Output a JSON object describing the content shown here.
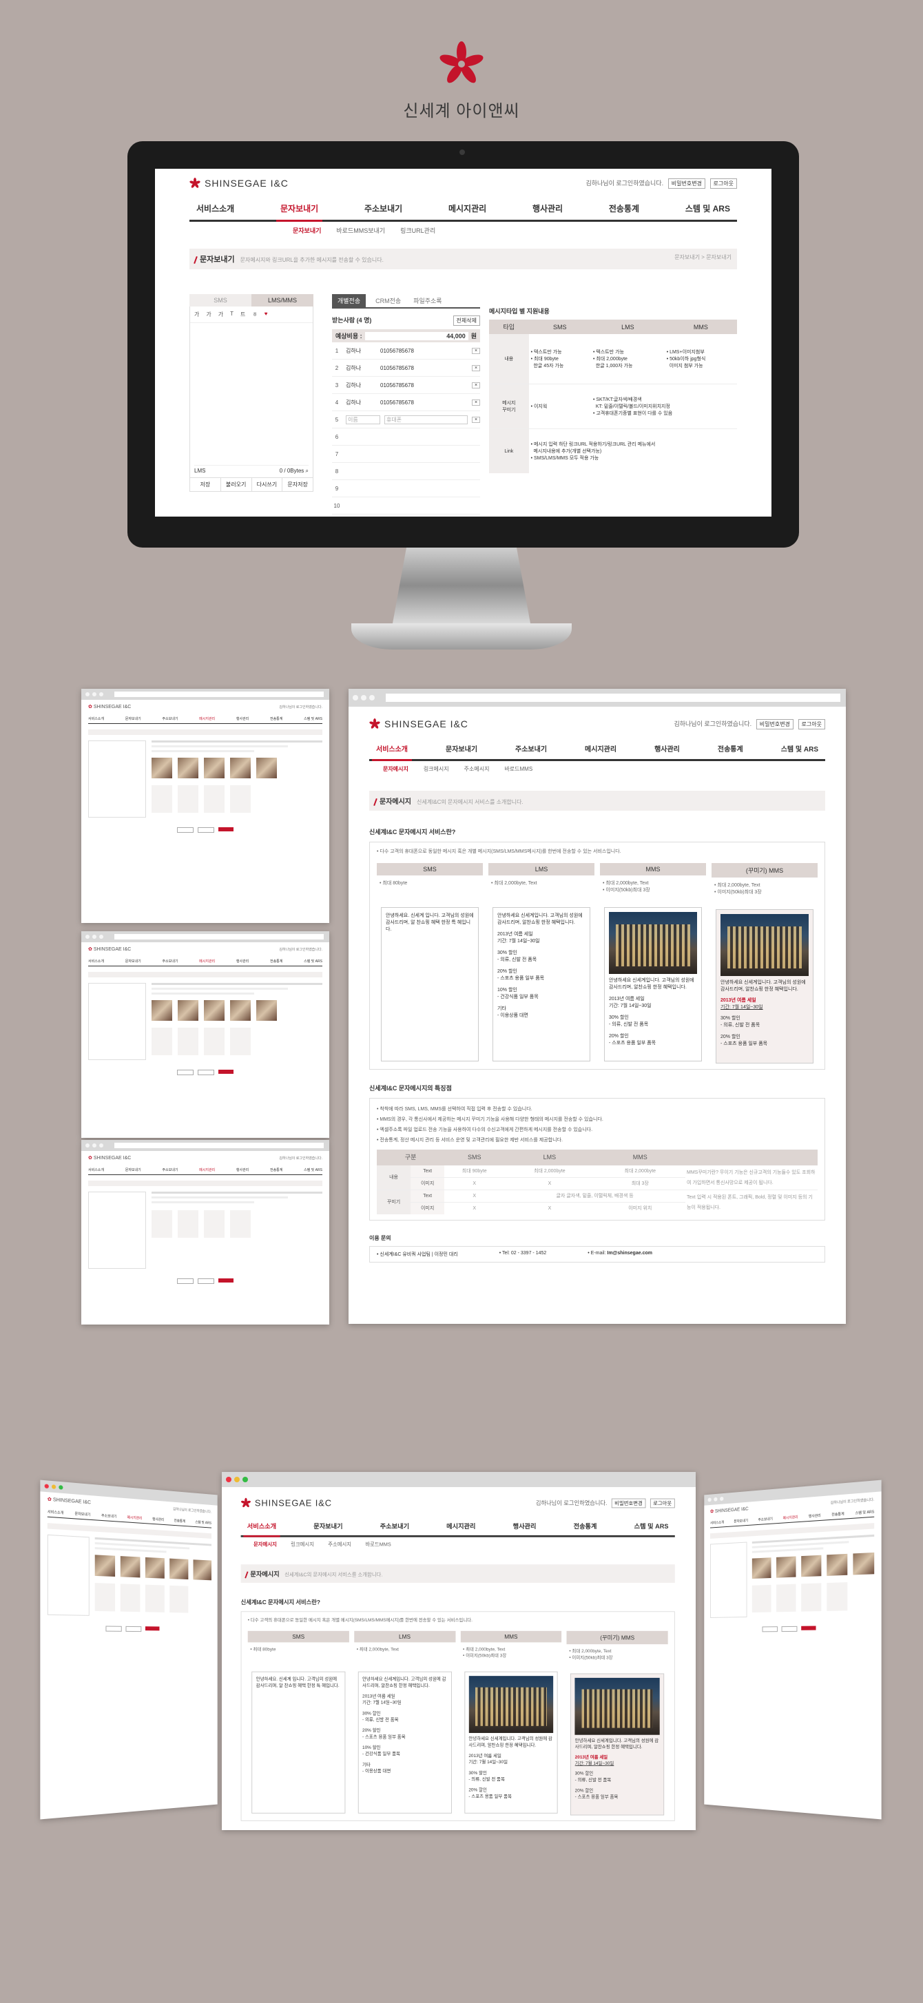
{
  "brand": {
    "name_ko": "신세계 아이앤씨",
    "logo_en": "SHINSEGAE I&C"
  },
  "header": {
    "greeting": "김하나님이 로그인하였습니다.",
    "btn_pw": "비밀번호변경",
    "btn_logout": "로그아웃"
  },
  "gnb": [
    "서비스소개",
    "문자보내기",
    "주소보내기",
    "메시지관리",
    "행사관리",
    "전송통계",
    "스템 및 ARS"
  ],
  "lnb_send": [
    "문자보내기",
    "바로드MMS보내기",
    "링크URL관리"
  ],
  "send_page": {
    "title": "문자보내기",
    "desc": "문자메시지와 링크URL을 추가한 메시지를 전송할 수 있습니다.",
    "breadcrumb": "문자보내기 > 문자보내기",
    "tabs": [
      "SMS",
      "LMS/MMS"
    ],
    "toolbar": [
      "가",
      "가",
      "가",
      "T",
      "트",
      "ㅎ",
      "♥"
    ],
    "counter_label": "LMS",
    "counter_value": "0 / 0Bytes",
    "bottom_btns": [
      "저장",
      "불러오기",
      "다시쓰기",
      "문자저장"
    ],
    "send_tabs": [
      "개별전송",
      "CRM전송",
      "파일주소록"
    ],
    "receivers_title": "받는사람 (4 명)",
    "receivers_btn": "전체삭제",
    "cost_label": "예상비용 :",
    "cost_value": "44,000",
    "cost_unit": "원",
    "receivers": [
      {
        "no": "1",
        "name": "김하나",
        "phone": "01056785678"
      },
      {
        "no": "2",
        "name": "김하나",
        "phone": "01056785678"
      },
      {
        "no": "3",
        "name": "김하나",
        "phone": "01056785678"
      },
      {
        "no": "4",
        "name": "김하나",
        "phone": "01056785678"
      },
      {
        "no": "5",
        "name": "이름",
        "phone": "휴대폰"
      },
      {
        "no": "6",
        "name": "",
        "phone": ""
      },
      {
        "no": "7",
        "name": "",
        "phone": ""
      },
      {
        "no": "8",
        "name": "",
        "phone": ""
      },
      {
        "no": "9",
        "name": "",
        "phone": ""
      },
      {
        "no": "10",
        "name": "",
        "phone": ""
      }
    ],
    "spec_title": "메시지타입 별 지원내용",
    "spec_headers": [
      "타입",
      "SMS",
      "LMS",
      "MMS"
    ],
    "spec_rows": [
      {
        "label": "내용",
        "sms": "• 텍스트만 가능\n• 최대 90byte\n  한글 45자 가능",
        "lms": "• 텍스트만 가능\n• 최대 2,000byte\n  한글 1,000자 가능",
        "mms": "• LMS+이미지첨부\n• 50kb이하 jpg형식\n  이미지 첨부 가능"
      },
      {
        "label": "메시지\n꾸미기",
        "all": "• 이지웍",
        "mms2": "• SKT/KT:글자색/배경색\n  KT: 밑줄/이탤릭/볼드/이미지위치지정\n• 고객휴대폰기종별 표현이 다를 수 있음"
      },
      {
        "label": "Link",
        "all2": "• 메시지 입력 하단 링크URL 적용하기/링크URL 관리 메뉴에서\n  메시지내용에 추가(개별 선택가능)\n• SMS/LMS/MMS 모두 적용 가능"
      }
    ]
  },
  "intro_page": {
    "lnb": [
      "문자메시지",
      "링크메시지",
      "주소메시지",
      "바로드MMS"
    ],
    "title": "문자메시지",
    "desc": "신세계I&C의 문자메시지 서비스를 소개합니다.",
    "q1": "신세계I&C 문자메시지 서비스란?",
    "q1_desc": "• 다수 고객의 휴대폰으로 동일한 메시지 혹은 개별 메시지(SMS/LMS/MMS메시지)를 한번에 전송할 수 있는 서비스입니다.",
    "cols": [
      {
        "name": "SMS",
        "spec": "• 최대 80byte",
        "spec2": ""
      },
      {
        "name": "LMS",
        "spec": "• 최대 2,000byte, Text",
        "spec2": ""
      },
      {
        "name": "MMS",
        "spec": "• 최대 2,000byte, Text",
        "spec2": "• 이미지(50kb)최대 3장"
      },
      {
        "name": "(꾸미기) MMS",
        "spec": "• 최대 2,000byte, Text",
        "spec2": "• 이미지(50kb)최대 3장"
      }
    ],
    "sample_sms": "안녕하세요. 신세계 입니다. 고객님의 성원에 감사드리며, 알 찬쇼핑 혜택 한정 특 혜입니다.",
    "sample_lms": "안녕하세요 신세계입니다. 고객님의 성원에 감사드리며, 알찬쇼핑 한정 혜택입니다.\n\n2013년 여름 세일\n기간: 7월 14일~30일\n\n30% 할인\n- 의류, 신발 전 품목\n\n20% 할인\n- 스포츠 용품 일부 품목\n\n10% 할인\n- 건강식품 일부 품목\n\n기타\n- 이용상품 대면",
    "sample_mms": "안녕하세요 신세계입니다. 고객님의 성원에 감사드리며, 알찬쇼핑 한정 혜택입니다.\n\n2013년 여름 세일\n기간: 7월 14일~30일\n\n30% 할인\n- 의류, 신발 전 품목\n\n20% 할인\n- 스포츠 용품 일부 품목",
    "sample_mms2_head": "안녕하세요 신세계입니다. 고객님의 성원에 감사드리며, 알찬쇼핑 한정 혜택입니다.",
    "sample_mms2_sale": "2013년 여름 세일",
    "sample_mms2_period": "기간: 7월 14일~30일",
    "sample_mms2_tail": "30% 할인\n- 의류, 신발 전 품목\n\n20% 할인\n- 스포츠 용품 일부 품목",
    "q2": "신세계I&C 문자메시지의 특징점",
    "q2_items": [
      "• 착착에 따라 SMS, LMS, MMS를 선택하여 직접 입력 후 전송할 수 있습니다.",
      "• MMS의 경우, 각 통신사에서 제공하는 메시지 꾸미기 기능을 사용해 다양한 형태의 메시지를 전송할 수 있습니다.",
      "• 엑셀주소록 파일 업로드 전송 기능을 사용하여 다수의 수신고객에게 간편하게 메시지를 전송할 수 있습니다.",
      "• 전송통계, 정산 메시지 관리 등 서비스 운영 및 고객관리에 필요한 제반 서비스를 제공합니다."
    ],
    "compare_headers": [
      "구분",
      "",
      "SMS",
      "LMS",
      "MMS",
      ""
    ],
    "compare_rows": [
      [
        "내용",
        "Text",
        "최대 90byte",
        "최대 2,000byte",
        "최대 2,000byte",
        "MMS꾸미기란? 무이기 기능은 신규고객의 기능들수 있도 조회하여 가입하면서 통신사망으로 제공이 됩니다."
      ],
      [
        "",
        "이미지",
        "X",
        "X",
        "최대 3장",
        ""
      ],
      [
        "꾸미기",
        "Text",
        "X",
        "글자 글자색, 밑줄, 이탤릭체, 배경색 등",
        "",
        "Text 입력 시 적용된 폰트, 그래픽, Bold, 정렬 및 이미지 등의 기능이 적용됩니다."
      ],
      [
        "",
        "이미지",
        "X",
        "X",
        "이미지 위치",
        ""
      ]
    ],
    "contact_title": "이용 문의",
    "contact": "• 신세계I&C 유비쿼 사업팀 | 이정민 대리",
    "tel": "• Tel: 02 - 3397 - 1452",
    "email_label": "• E-mail: ",
    "email": "Im@shinsegae.com"
  },
  "colors": {
    "bg": "#b4a9a5",
    "accent": "#c4142b",
    "gray": "#ddd5d2"
  }
}
